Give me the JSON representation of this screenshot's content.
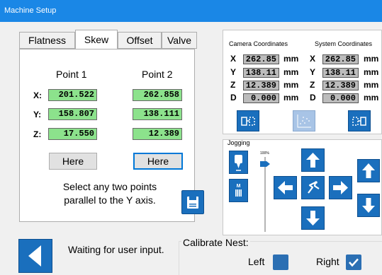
{
  "window": {
    "title": "Machine Setup"
  },
  "tabs": [
    "Flatness",
    "Skew",
    "Offset",
    "Valve"
  ],
  "skew": {
    "point1_header": "Point 1",
    "point2_header": "Point 2",
    "row_labels": [
      "X:",
      "Y:",
      "Z:"
    ],
    "point1": [
      "201.522",
      "158.807",
      "17.550"
    ],
    "point2": [
      "262.858",
      "138.111",
      "12.389"
    ],
    "here_label": "Here",
    "instruction_line1": "Select any two points",
    "instruction_line2": "parallel to the Y axis."
  },
  "coords": {
    "camera_title": "Camera Coordinates",
    "system_title": "System Coordinates",
    "axes": [
      "X",
      "Y",
      "Z",
      "D"
    ],
    "camera": [
      "262.85",
      "138.11",
      "12.389",
      "0.000"
    ],
    "system": [
      "262.85",
      "138.11",
      "12.389",
      "0.000"
    ],
    "unit": "mm"
  },
  "jogging": {
    "title": "Jogging",
    "speed_label": "100%",
    "speed_value": 0.95
  },
  "status": {
    "message": "Waiting for user input."
  },
  "calibrate": {
    "title": "Calibrate Nest:",
    "left_label": "Left",
    "right_label": "Right",
    "left_checked": false,
    "right_checked": true
  },
  "colors": {
    "accent": "#1a6fbd",
    "value_green": "#8ce28c",
    "title_bar": "#1a87e6"
  }
}
